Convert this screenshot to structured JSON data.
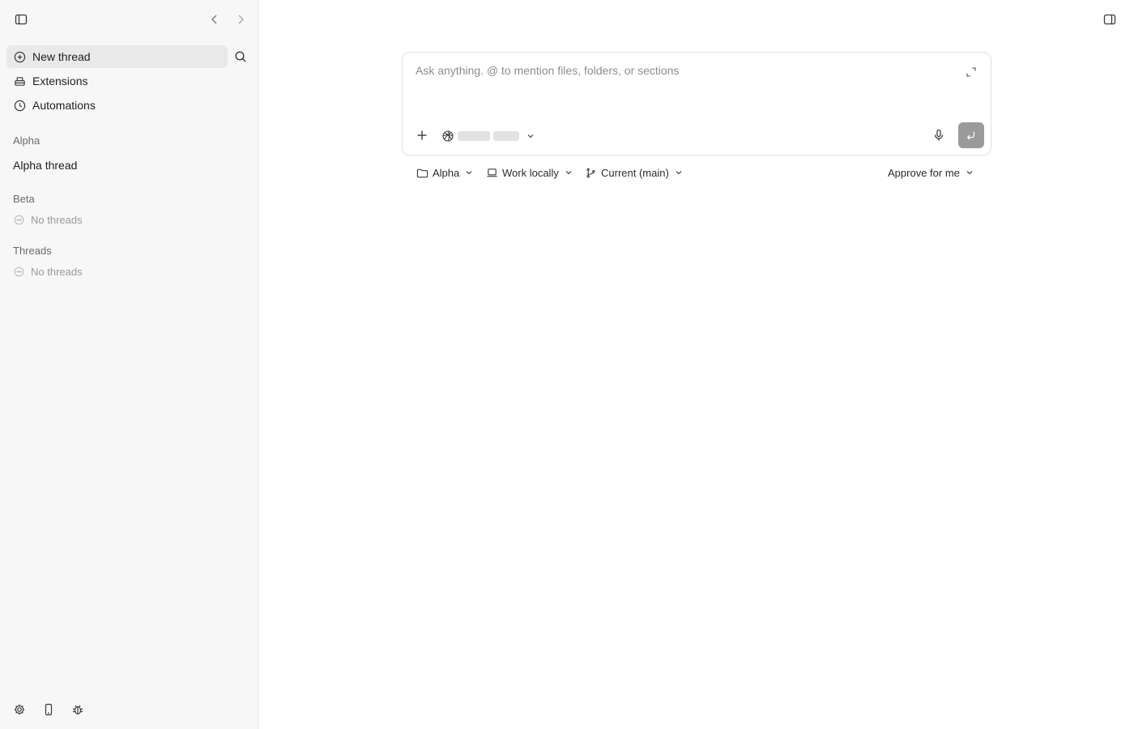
{
  "sidebar": {
    "nav": [
      {
        "label": "New thread",
        "icon": "plus-circle-icon",
        "active": true
      },
      {
        "label": "Extensions",
        "icon": "extensions-icon"
      },
      {
        "label": "Automations",
        "icon": "clock-icon"
      }
    ],
    "sections": [
      {
        "title": "Alpha",
        "threads": [
          "Alpha thread"
        ]
      },
      {
        "title": "Beta",
        "empty_text": "No threads"
      },
      {
        "title": "Threads",
        "empty_text": "No threads"
      }
    ]
  },
  "composer": {
    "placeholder": "Ask anything. @ to mention files, folders, or sections"
  },
  "options": {
    "project": "Alpha",
    "environment": "Work locally",
    "branch": "Current (main)",
    "approval": "Approve for me"
  },
  "colors": {
    "sidebar_bg": "#f7f7f7",
    "active_item_bg": "#e9e9e9",
    "send_button": "#9a9a9a"
  }
}
